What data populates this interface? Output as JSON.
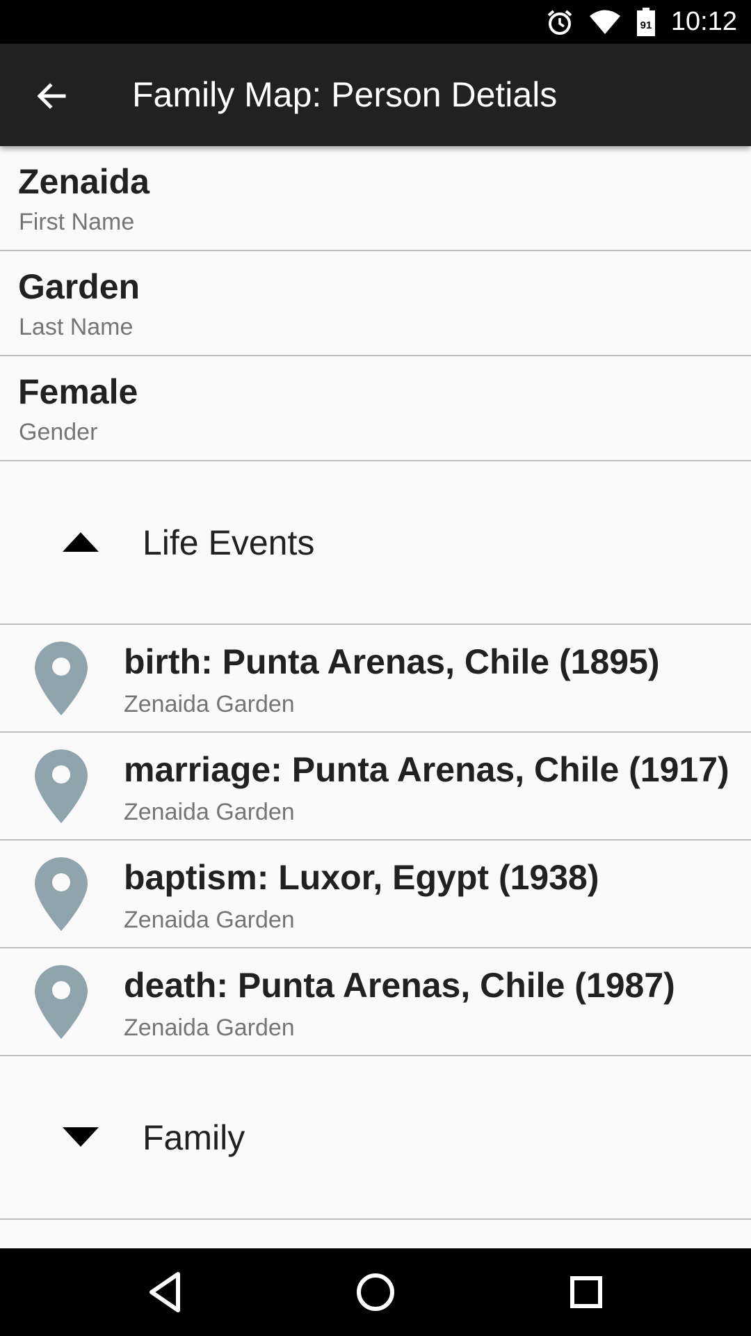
{
  "status_bar": {
    "time": "10:12",
    "battery_level": "91",
    "icons": [
      "alarm-icon",
      "wifi-icon",
      "battery-icon"
    ]
  },
  "app_bar": {
    "title": "Family Map: Person Detials",
    "back_icon": "arrow-left-icon"
  },
  "person": {
    "fields": [
      {
        "value": "Zenaida",
        "label": "First Name"
      },
      {
        "value": "Garden",
        "label": "Last Name"
      },
      {
        "value": "Female",
        "label": "Gender"
      }
    ]
  },
  "life_events": {
    "label": "Life Events",
    "expanded": true,
    "items": [
      {
        "title": "birth: Punta Arenas, Chile (1895)",
        "person": "Zenaida Garden"
      },
      {
        "title": "marriage: Punta Arenas, Chile (1917)",
        "person": "Zenaida Garden"
      },
      {
        "title": "baptism: Luxor, Egypt (1938)",
        "person": "Zenaida Garden"
      },
      {
        "title": "death: Punta Arenas, Chile (1987)",
        "person": "Zenaida Garden"
      }
    ]
  },
  "family": {
    "label": "Family",
    "expanded": false
  },
  "colors": {
    "app_bar": "#212121",
    "pin": "#90a4ae",
    "divider": "#bdbdbd",
    "secondary_text": "#757575"
  },
  "nav_bar": {
    "icons": [
      "back-triangle-icon",
      "home-circle-icon",
      "recents-square-icon"
    ]
  }
}
